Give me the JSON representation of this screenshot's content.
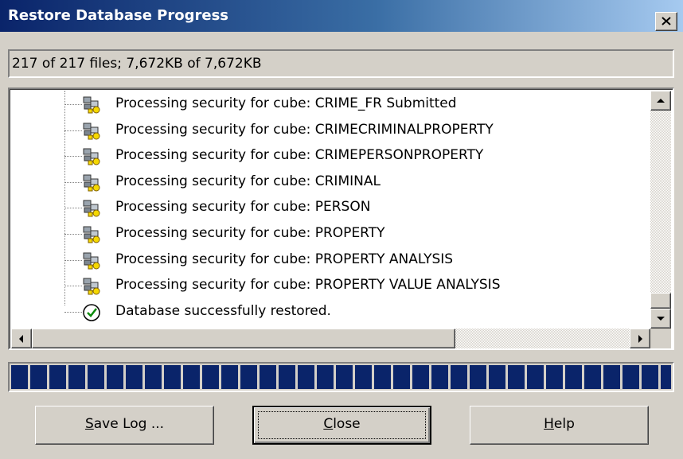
{
  "window": {
    "title": "Restore Database Progress"
  },
  "status": {
    "text": "217 of 217 files; 7,672KB of 7,672KB"
  },
  "log": {
    "items": [
      {
        "label": "Processing security for cube: CRIME_FR Submitted",
        "icon": "cubes-icon"
      },
      {
        "label": "Processing security for cube: CRIMECRIMINALPROPERTY",
        "icon": "cubes-icon"
      },
      {
        "label": "Processing security for cube: CRIMEPERSONPROPERTY",
        "icon": "cubes-icon"
      },
      {
        "label": "Processing security for cube: CRIMINAL",
        "icon": "cubes-icon"
      },
      {
        "label": "Processing security for cube: PERSON",
        "icon": "cubes-icon"
      },
      {
        "label": "Processing security for cube: PROPERTY",
        "icon": "cubes-icon"
      },
      {
        "label": "Processing security for cube: PROPERTY ANALYSIS",
        "icon": "cubes-icon"
      },
      {
        "label": "Processing security for cube: PROPERTY VALUE ANALYSIS",
        "icon": "cubes-icon"
      },
      {
        "label": "Database successfully restored.",
        "icon": "check-circle-icon"
      }
    ]
  },
  "progress": {
    "percent": 100,
    "color": "#0a246a"
  },
  "buttons": {
    "save_log": {
      "mnemonic": "S",
      "rest": "ave Log ..."
    },
    "close": {
      "mnemonic": "C",
      "rest": "lose"
    },
    "help": {
      "mnemonic": "H",
      "rest": "elp"
    }
  },
  "colors": {
    "titlebar": "#0a246a",
    "face": "#d4d0c8"
  }
}
